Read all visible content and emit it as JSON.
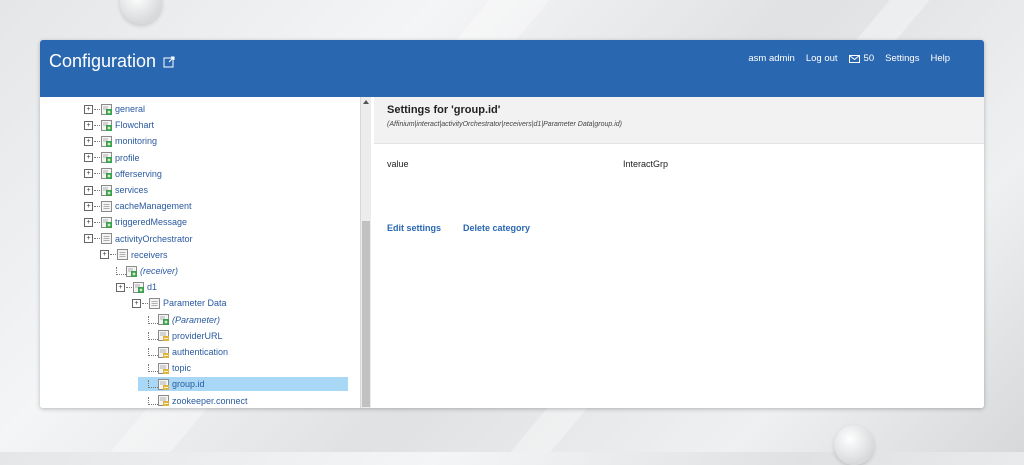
{
  "app": {
    "title": "Configuration"
  },
  "topnav": {
    "user": "asm admin",
    "logout": "Log out",
    "mail_count": "50",
    "settings": "Settings",
    "help": "Help"
  },
  "tree": {
    "items": [
      {
        "label": "general",
        "italic": false,
        "selected": false
      },
      {
        "label": "Flowchart",
        "italic": false,
        "selected": false
      },
      {
        "label": "monitoring",
        "italic": false,
        "selected": false
      },
      {
        "label": "profile",
        "italic": false,
        "selected": false
      },
      {
        "label": "offerserving",
        "italic": false,
        "selected": false
      },
      {
        "label": "services",
        "italic": false,
        "selected": false
      },
      {
        "label": "cacheManagement",
        "italic": false,
        "selected": false
      },
      {
        "label": "triggeredMessage",
        "italic": false,
        "selected": false
      },
      {
        "label": "activityOrchestrator",
        "italic": false,
        "selected": false
      },
      {
        "label": "receivers",
        "italic": false,
        "selected": false
      },
      {
        "label": "(receiver)",
        "italic": true,
        "selected": false
      },
      {
        "label": "d1",
        "italic": false,
        "selected": false
      },
      {
        "label": "Parameter Data",
        "italic": false,
        "selected": false
      },
      {
        "label": "(Parameter)",
        "italic": true,
        "selected": false
      },
      {
        "label": "providerURL",
        "italic": false,
        "selected": false
      },
      {
        "label": "authentication",
        "italic": false,
        "selected": false
      },
      {
        "label": "topic",
        "italic": false,
        "selected": false
      },
      {
        "label": "group.id",
        "italic": false,
        "selected": true
      },
      {
        "label": "zookeeper.connect",
        "italic": false,
        "selected": false
      }
    ]
  },
  "detail": {
    "title": "Settings for 'group.id'",
    "path": "(Affinium|interact|activityOrchestrator|receivers|d1|Parameter Data|group.id)",
    "property_name": "value",
    "property_value": "InteractGrp",
    "edit_label": "Edit settings",
    "delete_label": "Delete category"
  },
  "colors": {
    "header": "#2a67b1",
    "link": "#2a67b1",
    "selection": "#a8d8f5"
  },
  "icons": [
    "external-link-icon",
    "mail-icon",
    "folder-icon",
    "document-icon",
    "plus-badge-icon",
    "scroll-up-arrow-icon"
  ]
}
